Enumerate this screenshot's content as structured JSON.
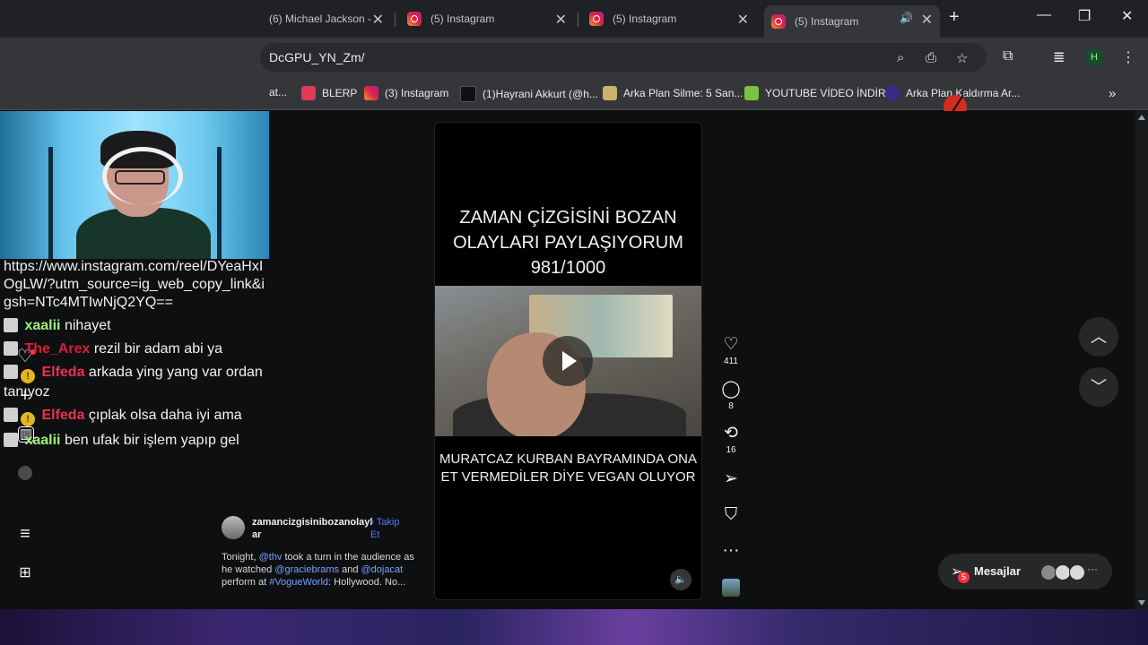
{
  "browser": {
    "tabs": [
      {
        "title": "(6) Michael Jackson - "
      },
      {
        "title": "(5) Instagram"
      },
      {
        "title": "(5) Instagram"
      },
      {
        "title": "(5) Instagram"
      }
    ],
    "url_visible": "DcGPU_YN_Zm/",
    "profile_initial": "H",
    "bookmarks": [
      {
        "label": "at..."
      },
      {
        "label": "BLERP"
      },
      {
        "label": "(3) Instagram"
      },
      {
        "label": "(1)Hayrani Akkurt (@h..."
      },
      {
        "label": "Arka Plan Silme: 5 San..."
      },
      {
        "label": "YOUTUBE VİDEO İNDİR"
      },
      {
        "label": "Arka Plan Kaldırma Ar..."
      }
    ]
  },
  "chat": {
    "link_text": "https://www.instagram.com/reel/DYeaHxIOgLW/?utm_source=ig_web_copy_link&igsh=NTc4MTIwNjQ2YQ==",
    "messages": [
      {
        "user": "xaalii",
        "text": "nihayet",
        "color": "#9ef07a"
      },
      {
        "user": "The_Arex",
        "text": "rezil bir adam abi ya",
        "color": "#d61f3a"
      },
      {
        "user": "Elfeda",
        "text": "arkada ying yang var ordan tanıyoz",
        "color": "#e8324f"
      },
      {
        "user": "Elfeda",
        "text": "çıplak olsa daha iyi ama",
        "color": "#e8324f"
      },
      {
        "user": "xaalii",
        "text": "ben ufak bir işlem yapıp gel",
        "color": "#9ef07a"
      }
    ]
  },
  "reel": {
    "title_lines": [
      "ZAMAN ÇİZGİSİNİ BOZAN",
      "OLAYLARI PAYLAŞIYORUM",
      "981/1000"
    ],
    "caption_lines": [
      "MURATCAZ KURBAN BAYRAMINDA ONA",
      "ET VERMEDİLER DİYE VEGAN OLUYOR"
    ]
  },
  "actions": {
    "likes": "411",
    "comments": "8",
    "reposts": "16"
  },
  "post": {
    "username": "zamancizgisinibozanolaylar",
    "follow": "Takip Et",
    "desc_parts": {
      "p1": "Tonight, ",
      "m1": "@thv",
      "p2": " took a turn in the audience as he watched ",
      "m2": "@graciebrams",
      "p3": " and ",
      "m3": "@dojacat",
      "p4": " perform at ",
      "m4": "#VogueWorld",
      "p5": ": Hollywood. No..."
    }
  },
  "messages_button": {
    "label": "Mesajlar",
    "badge": "5"
  },
  "colors": {
    "accent_blue": "#4f7cff",
    "notification_red": "#ff3040"
  }
}
